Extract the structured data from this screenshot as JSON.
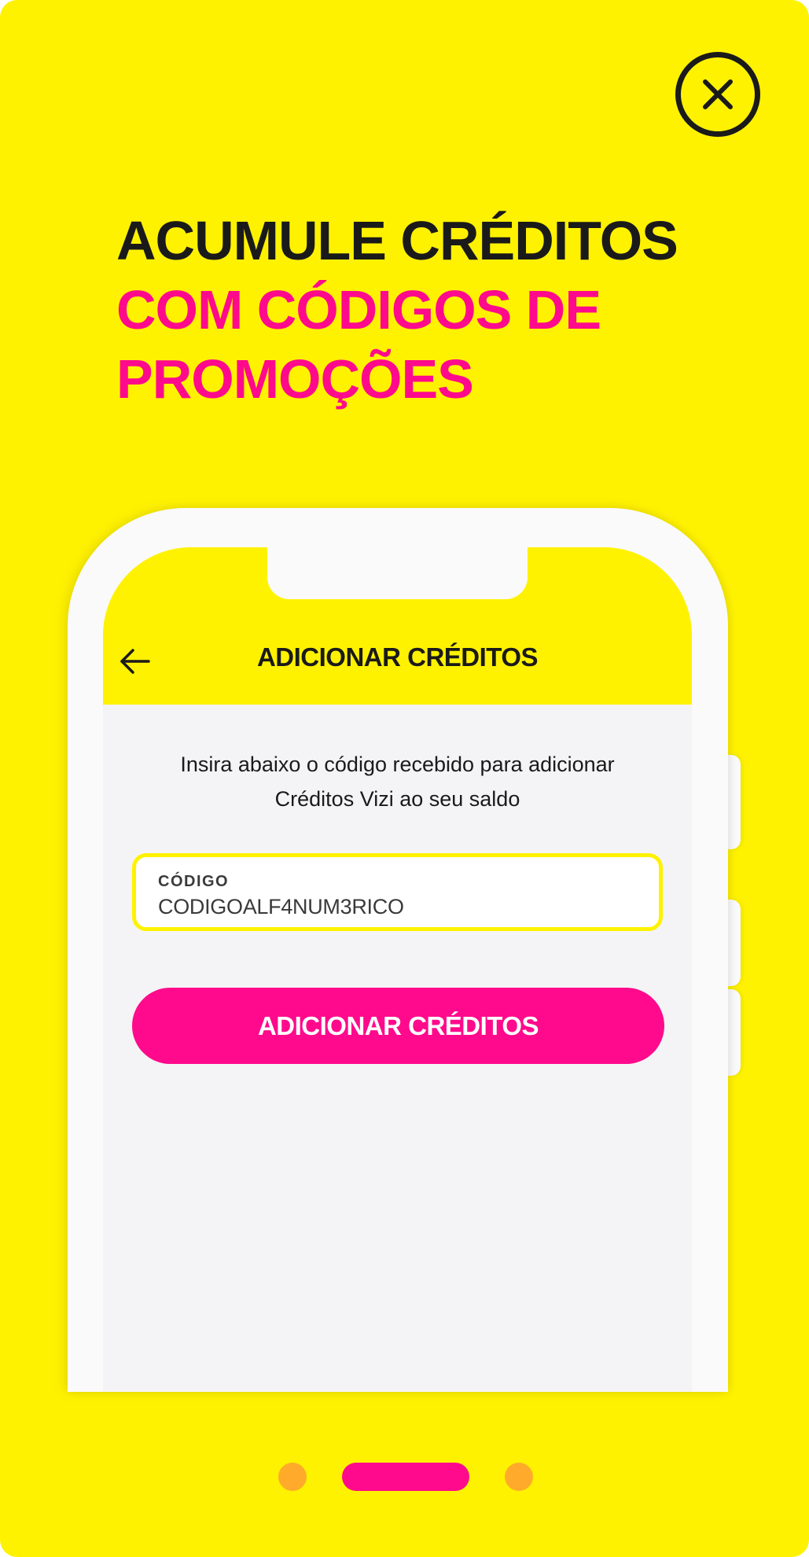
{
  "close": {
    "icon": "close-icon"
  },
  "headline": {
    "line1": "ACUMULE CRÉDITOS",
    "line2": "COM CÓDIGOS DE",
    "line3": "PROMOÇÕES"
  },
  "app": {
    "back_icon": "arrow-left-icon",
    "title": "ADICIONAR CRÉDITOS",
    "instructions_line1": "Insira abaixo o código recebido para adicionar",
    "instructions_line2": "Créditos Vizi ao seu saldo",
    "code_field": {
      "label": "CÓDIGO",
      "value": "CODIGOALF4NUM3RICO"
    },
    "submit_label": "ADICIONAR CRÉDITOS"
  },
  "pagination": {
    "count": 3,
    "active": 1
  },
  "colors": {
    "background": "#FFF200",
    "accent": "#FF0A8C",
    "dot_inactive": "#FFAA2A",
    "text_dark": "#1A1A1A"
  }
}
